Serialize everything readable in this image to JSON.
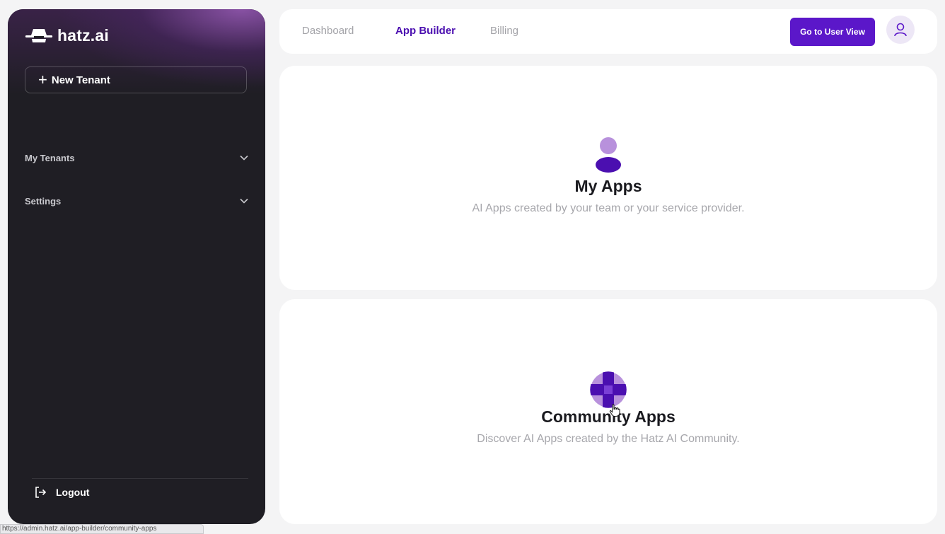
{
  "sidebar": {
    "brand": "hatz.ai",
    "new_tenant_label": "New Tenant",
    "groups": [
      {
        "label": "My Tenants"
      },
      {
        "label": "Settings"
      }
    ],
    "logout_label": "Logout"
  },
  "topbar": {
    "tabs": [
      {
        "label": "Dashboard",
        "active": false
      },
      {
        "label": "App Builder",
        "active": true
      },
      {
        "label": "Billing",
        "active": false
      }
    ],
    "user_view_label": "Go to User View"
  },
  "cards": {
    "my_apps": {
      "title": "My Apps",
      "subtitle": "AI Apps created by your team or your service provider.",
      "icon": "person-icon"
    },
    "community_apps": {
      "title": "Community Apps",
      "subtitle": "Discover AI Apps created by the Hatz AI Community.",
      "icon": "globe-icon"
    }
  },
  "status_bar": {
    "url": "https://admin.hatz.ai/app-builder/community-apps"
  },
  "colors": {
    "accent": "#5b17c9",
    "sidebar_bg": "#1f1e24",
    "active_tab": "#4b0fb0"
  }
}
